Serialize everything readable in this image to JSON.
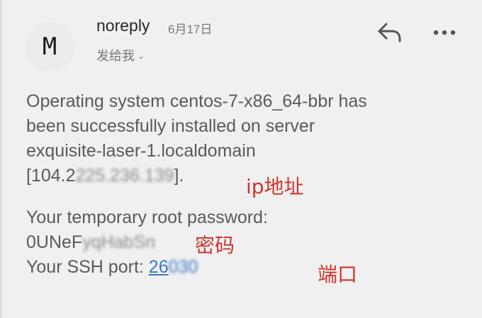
{
  "header": {
    "avatar_letter": "M",
    "sender": "noreply",
    "date": "6月17日",
    "recipient": "发给我",
    "reply_icon": "reply-icon",
    "more_icon": "more-icon"
  },
  "message": {
    "line1": "Operating system centos-7-x86_64-bbr has",
    "line2": "been successfully installed on server",
    "line3": "exquisite-laser-1.localdomain",
    "ip_prefix": "[104.2",
    "ip_redacted": "225.236.139",
    "ip_suffix": "].",
    "password_label": "Your temporary root password:",
    "password_prefix": "0UNeF",
    "password_redacted": "yqHabSn",
    "port_label": "Your SSH port:",
    "port_prefix": "26",
    "port_redacted": "030"
  },
  "annotations": {
    "ip": "ip地址",
    "password": "密码",
    "port": "端口",
    "color": "#d0342c"
  }
}
